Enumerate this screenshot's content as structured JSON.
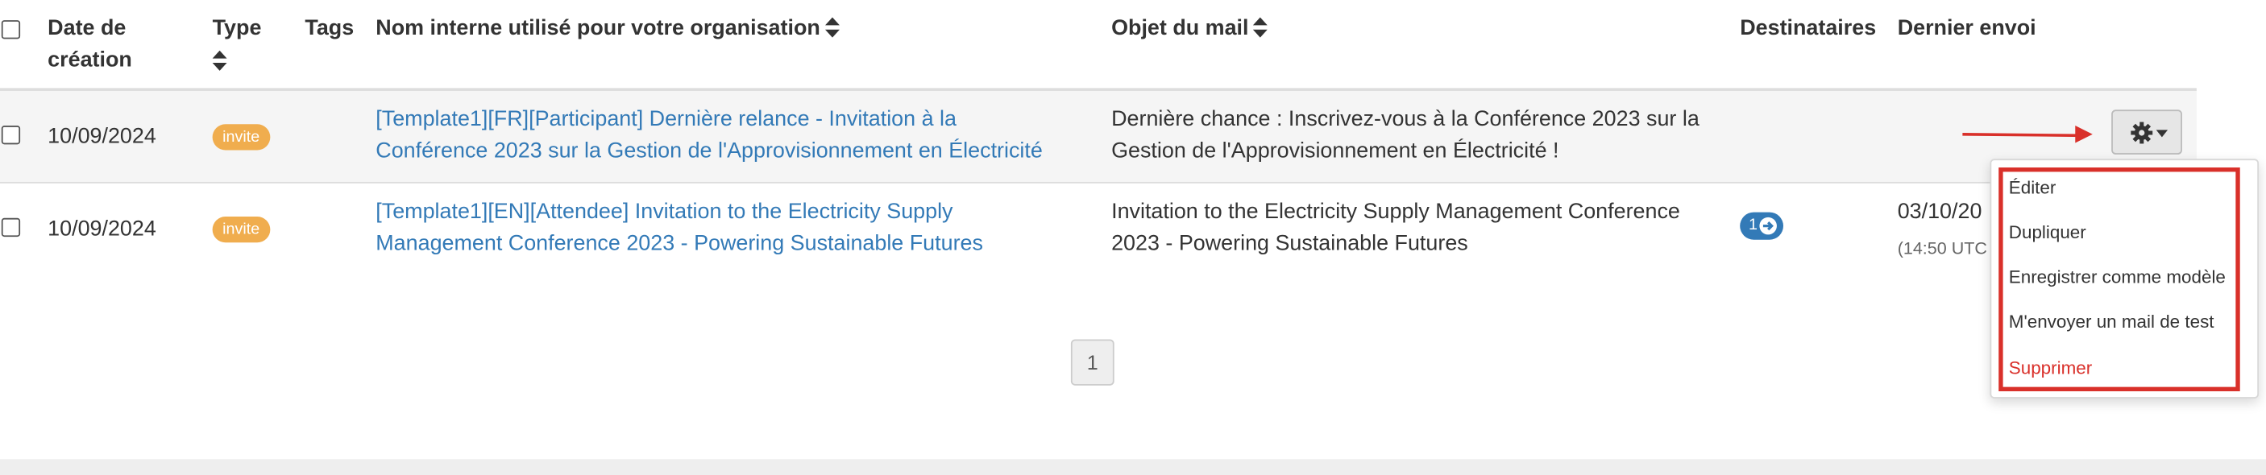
{
  "table": {
    "headers": {
      "date_line1": "Date de",
      "date_line2": "création",
      "type": "Type",
      "tags": "Tags",
      "internal_name": "Nom interne utilisé pour votre organisation",
      "subject": "Objet du mail",
      "recipients": "Destinataires",
      "last_sent": "Dernier envoi"
    },
    "rows": [
      {
        "date": "10/09/2024",
        "type": "invite",
        "name_line1": "[Template1][FR][Participant] Dernière relance - Invitation à la",
        "name_line2": "Conférence 2023 sur la Gestion de l'Approvisionnement en Électricité",
        "subject_line1": "Dernière chance : Inscrivez-vous à la Conférence 2023 sur la",
        "subject_line2": "Gestion de l'Approvisionnement en Électricité !"
      },
      {
        "date": "10/09/2024",
        "type": "invite",
        "name_line1": "[Template1][EN][Attendee] Invitation to the Electricity Supply",
        "name_line2": "Management Conference 2023 - Powering Sustainable Futures",
        "subject_line1": "Invitation to the Electricity Supply Management Conference",
        "subject_line2": "2023 - Powering Sustainable Futures",
        "recipients_count": "1",
        "last_sent_date": "03/10/20",
        "last_sent_time": "(14:50 UTC"
      }
    ]
  },
  "actions_menu": {
    "items": [
      {
        "label": "Éditer"
      },
      {
        "label": "Dupliquer"
      },
      {
        "label": "Enregistrer comme modèle"
      },
      {
        "label": "M'envoyer un mail de test"
      },
      {
        "label": "Supprimer"
      }
    ]
  },
  "pagination": {
    "current_page": "1"
  },
  "colors": {
    "link": "#337ab7",
    "badge": "#f0ad4e",
    "annotation": "#d9302a",
    "danger": "#d9302a"
  },
  "icons": [
    "sort-icon",
    "gear-icon",
    "caret-down-icon",
    "arrow-circle-right-icon",
    "annotation-arrow-icon"
  ]
}
